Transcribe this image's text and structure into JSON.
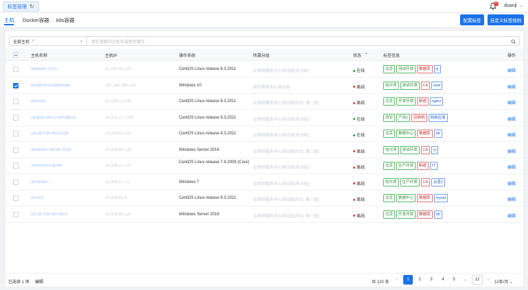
{
  "topbar": {
    "tab_label": "标签管理",
    "refresh_glyph": "↻",
    "notification_count": "6",
    "username": "duanjl"
  },
  "subtabs": [
    "主机",
    "Docker容器",
    "k8s容器"
  ],
  "actions": {
    "configure_tags": "配置标签",
    "custom_tag_rules": "自定义标签规则"
  },
  "filter": {
    "scope_value": "全部主机",
    "scope_clear": "×",
    "search_placeholder": "请在搜索的主机名或者关键字"
  },
  "columns": {
    "hostname": "主机名称",
    "ip": "主机IP",
    "os": "操作系统",
    "group": "所属分组",
    "status": "状态",
    "tags": "标签信息",
    "actions": "操作"
  },
  "rows": [
    {
      "hostname": "windows-2015",
      "ip": "10.200.45.120",
      "os": "CentOS Linux release 6.3.2011",
      "group": "云原则服务中心测试组(未分组)",
      "status": "在线",
      "status_color": "#2e9e44",
      "checked": false,
      "tags": [
        [
          "北京",
          "green"
        ],
        [
          "测试环境",
          "green"
        ],
        [
          "数据库",
          "red"
        ],
        [
          "ly",
          "blue"
        ]
      ]
    },
    {
      "hostname": "localhost.localdomain",
      "ip": "192.168.196.130",
      "os": "Windows 10",
      "group": "有巨服务中心测试组",
      "status": "离线",
      "status_color": "#e53935",
      "checked": true,
      "tags": [
        [
          "哈尔滨",
          "green"
        ],
        [
          "测试环境",
          "green"
        ],
        [
          "CA",
          "red"
        ],
        [
          "web",
          "blue"
        ]
      ]
    },
    {
      "hostname": "win2003",
      "ip": "10.208.170.66",
      "os": "CentOS Linux release 8.3.2011",
      "group": "云原则服务中心测试组(POC 第一组)",
      "status": "离线",
      "status_color": "#e53935",
      "checked": false,
      "tags": [
        [
          "北京",
          "green"
        ],
        [
          "开发环境",
          "green"
        ],
        [
          "制造",
          "red"
        ],
        [
          "nginx",
          "blue"
        ]
      ]
    },
    {
      "hostname": "caoyue-cet-12-bmo8616",
      "ip": "10.208.177.228",
      "os": "CentOS Linux release 8.3.2011",
      "group": "云原则服务中心测试组(未分组)",
      "status": "在线",
      "status_color": "#2e9e44",
      "checked": false,
      "tags": [
        [
          "西安",
          "green"
        ],
        [
          "产线1",
          "green"
        ],
        [
          "应刷机",
          "red"
        ],
        [
          "网络应用",
          "blue"
        ]
      ]
    },
    {
      "hostname": "DESKTOP-4GS1QB",
      "ip": "10.208.61.220",
      "os": "CentOS Linux release 8.3.2011",
      "group": "云原则服务中心测试组(未分组)",
      "status": "在线",
      "status_color": "#2e9e44",
      "checked": false,
      "tags": [
        [
          "北京",
          "green"
        ],
        [
          "数据中心",
          "green"
        ],
        [
          "数据库",
          "red"
        ],
        [
          "db",
          "blue"
        ]
      ]
    },
    {
      "hostname": "Windows Server 2016",
      "ip": "10.208.65.128",
      "os": "Windows Server 2016",
      "group": "云原则服务中心测试组(POC 第二组)",
      "status": "离线",
      "status_color": "#e53935",
      "checked": false,
      "tags": [
        [
          "哈尔滨",
          "green"
        ],
        [
          "测试环境",
          "green"
        ],
        [
          "CA",
          "red"
        ],
        [
          "ly",
          "blue"
        ]
      ]
    },
    {
      "hostname": "centos6-ecsg-ten",
      "ip": "10.208.177.47",
      "os": "CentOS Linux release 7.9.2009 (Core)",
      "group": "云原则服务中心测试组(未分组)",
      "status": "离线",
      "status_color": "#e53935",
      "checked": false,
      "tags": [
        [
          "北京",
          "green"
        ],
        [
          "生产环境",
          "green"
        ],
        [
          "制造",
          "red"
        ],
        [
          "IT",
          "blue"
        ]
      ]
    },
    {
      "hostname": "Windows 7",
      "ip": "10.208.177.5",
      "os": "Windows 7",
      "group": "云原则服务中心测试组(未分组)",
      "status": "离线",
      "status_color": "#e53935",
      "checked": false,
      "tags": [
        [
          "哈尔滨",
          "green"
        ],
        [
          "生产环境",
          "green"
        ],
        [
          "CA",
          "red"
        ],
        [
          "云查1",
          "blue"
        ]
      ]
    },
    {
      "hostname": "linux01",
      "ip": "10.208.61.6",
      "os": "CentOS Linux release 8.3.2011",
      "group": "云原则服务中心测试组(POC 第一组)",
      "status": "离线",
      "status_color": "#e53935",
      "checked": false,
      "tags": [
        [
          "北京",
          "green"
        ],
        [
          "数据中心",
          "green"
        ],
        [
          "数据库",
          "red"
        ],
        [
          "mysql",
          "blue"
        ]
      ]
    },
    {
      "hostname": "DESKTOP-9RS6D1",
      "ip": "10.208.65.120",
      "os": "Windows Server 2016",
      "group": "云原则服务中心测试组(POC 第一组)",
      "status": "离线",
      "status_color": "#e53935",
      "checked": false,
      "tags": [
        [
          "北京",
          "green"
        ],
        [
          "开发环境",
          "green"
        ],
        [
          "数据库",
          "red"
        ],
        [
          "db",
          "blue"
        ]
      ]
    }
  ],
  "row_action": "编辑",
  "footer": {
    "selected": "已选择 1 项",
    "bulk_edit": "编辑",
    "total": "共 120 条",
    "prev": "‹",
    "pages": [
      "1",
      "2",
      "3",
      "4",
      "5",
      "...",
      "12"
    ],
    "next": "›",
    "page_size": "10条/页 ⌄"
  },
  "colors": {
    "accent": "#1a73e8",
    "online": "#2e9e44",
    "offline": "#e53935"
  }
}
